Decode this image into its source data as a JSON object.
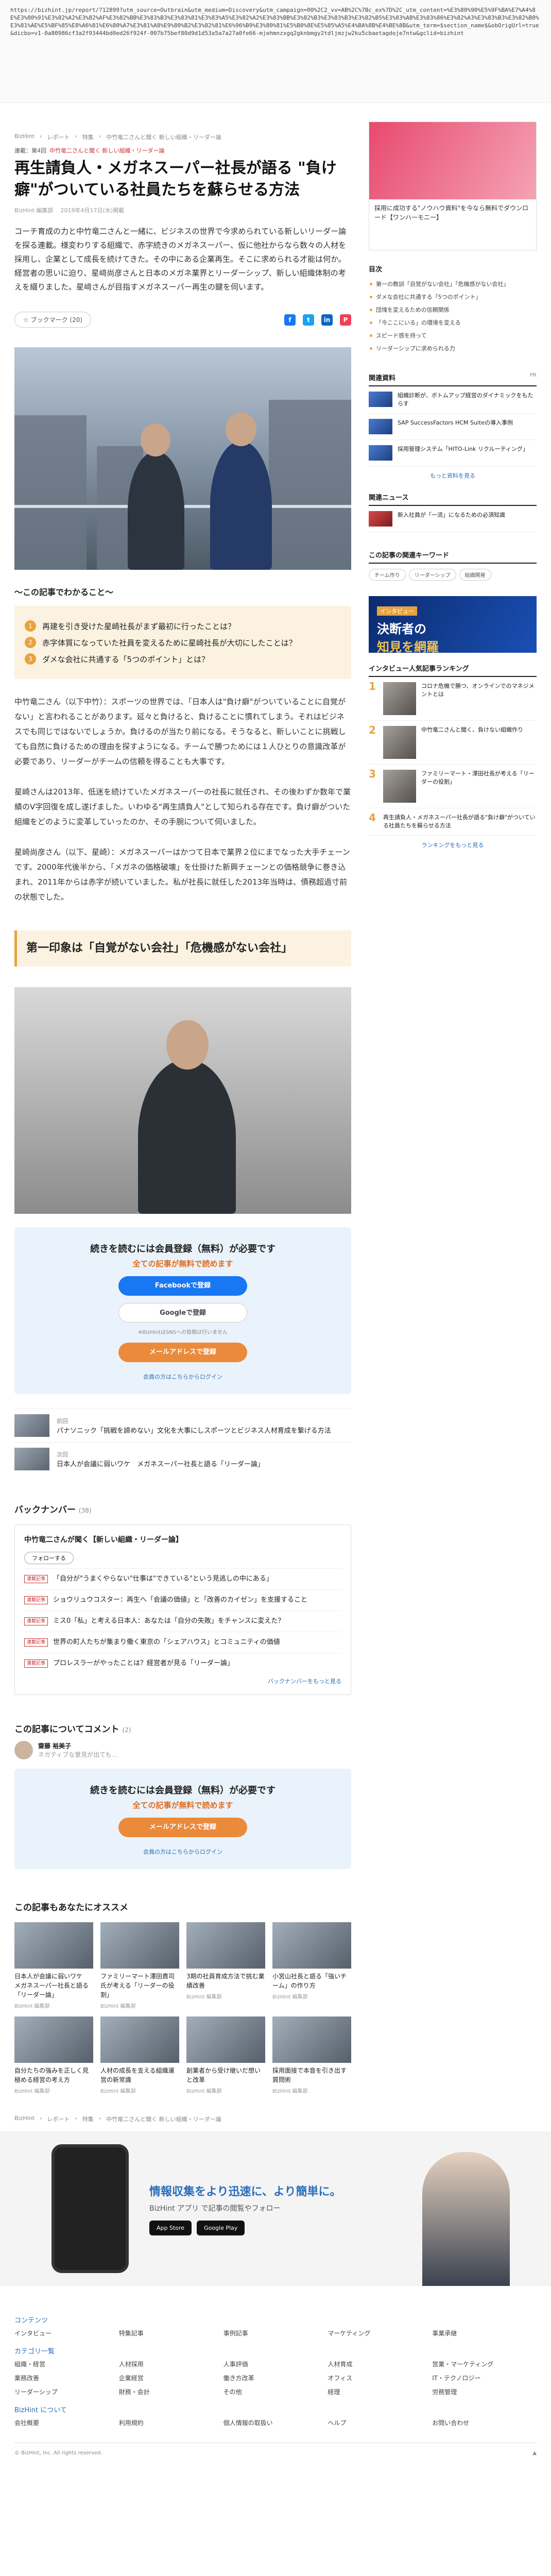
{
  "url_text": "https://bizhint.jp/report/?12899?utm_source=Outbrain&utm_medium=Discovery&utm_campaign=00%2C2_vv=AB%2C%7Bc_ex%7D%2C_utm_content=%E3%80%90%E5%9F%BA%E7%A4%8E%E3%80%91%E3%82%A2%E3%82%AF%E3%82%BB%E3%83%B3%E3%83%81%E3%83%A5%E3%82%A2%E3%83%BB%E3%82%B3%E3%83%B3%E3%82%B5%E3%83%AB%E3%83%86%E3%82%A3%E3%83%B3%E3%82%B0%E3%81%AE%E5%BF%85%E8%A6%81%E6%80%A7%E3%81%A8%E9%80%B2%E3%82%81%E6%96%B9%E3%80%81%E5%B0%8E%E5%85%A5%E4%BA%8B%E4%BE%8B&utm_term=$section_name$&obOrigUrl=true&dicbo=v1-0a80986cf3a2f93444bd0ed26f924f-007b75bef80d9d1d53a5a7a27a0fe66-mjehmnzxgq2gknbmgy2tdljmzjw2ku5cbaetagdoje7ntw&gclid=bizhint",
  "breadcrumb": [
    "BizHint",
    "レポート",
    "特集",
    "中竹竜二さんと聞く 新しい組織・リーダー論"
  ],
  "article": {
    "series_label": "連載：第4回",
    "series_name": "中竹竜二さんと聞く 新しい組織・リーダー論",
    "title": "再生請負人・メガネスーパー社長が語る \"負け癖\"がついている社員たちを蘇らせる方法",
    "byline": "BizHint 編集部",
    "date": "2019年4月17日(水)掲載",
    "lead": "コーチ育成の力と中竹竜二さんと一緒に、ビジネスの世界で今求められている新しいリーダー論を探る連載。様変わりする組織で、赤字続きのメガネスーパー、仮に他社からなら数々の人材を採用し、企業として成長を続けてきた。その中にある企業再生。そこに求められる才能は何か。経営者の思いに迫り、星﨑尚彦さんと日本のメガネ業界とリーダーシップ、新しい組織体制の考えを綴りました。星﨑さんが目指すメガネスーパー再生の鍵を伺います。",
    "bookmark_label": "ブックマーク",
    "bookmark_count": "(20)"
  },
  "toc": {
    "heading": "この記事でわかること",
    "items": [
      "再建を引き受けた星崎社長がまず最初に行ったことは？",
      "赤字体質になっていた社員を変えるために星崎社長が大切にしたことは？",
      "ダメな会社に共通する「5つのポイント」とは？"
    ]
  },
  "paragraphs": [
    "中竹竜二さん（以下中竹）：スポーツの世界では、「日本人は\"負け癖\"がついていることに自覚がない」と言われることがあります。延々と負けると、負けることに慣れてしまう。それはビジネスでも同じではないでしょうか。負けるのが当たり前になる。そうなると、新しいことに挑戦しても自然に負けるための理由を探すようになる。チームで勝つためには１人ひとりの意識改革が必要であり、リーダーがチームの信頼を得ることも大事です。",
    "星崎さんは2013年、低迷を続けていたメガネスーパーの社長に就任され、その後わずか数年で業績のV字回復を成し遂げました。いわゆる\"再生請負人\"として知られる存在です。負け癖がついた組織をどのように変革していったのか、その手腕について伺いました。",
    "星崎尚彦さん（以下、星崎）：メガネスーパーはかつて日本で業界２位にまでなった大手チェーンです。2000年代後半から、「メガネの価格破壊」を仕掛けた新興チェーンとの価格競争に巻き込まれ、2011年からは赤字が続いていました。私が社長に就任した2013年当時は、債務超過寸前の状態でした。"
  ],
  "h2": "第一印象は「自覚がない会社」「危機感がない会社」",
  "gate": {
    "t1": "続きを読むには会員登録（無料）が必要です",
    "t2": "全ての記事が無料で読めます",
    "fb": "Facebookで登録",
    "google": "Googleで登録",
    "note": "※BizHintはSNSへの投稿は行いません",
    "mail": "メールアドレスで登録",
    "login": "会員の方はこちらからログイン"
  },
  "related": [
    {
      "meta": "前回",
      "title": "パナソニック「挑戦を諦めない」文化を大事にしスポーツとビジネス人材育成を繋げる方法"
    },
    {
      "meta": "次回",
      "title": "日本人が会議に弱いワケ　メガネスーパー社長と語る「リーダー論」"
    }
  ],
  "backnumber": {
    "heading": "バックナンバー",
    "count": "(38)",
    "series": "中竹竜二さんが聞く【新しい組織・リーダー論】",
    "follow": "フォローする",
    "tag": "連載記事",
    "items": [
      "「自分が\"うまくやらない\"仕事は\"できている\"という見逃しの中にある」",
      "ショウリュウコスター：再生へ「会議の価値」と「改善のカイゼン」を支援すること",
      "ミス0「私」と考える日本人：あなたは「自分の失敗」をチャンスに変えた？",
      "世界の町人たちが集まり働く東京の「シェアハウス」とコミュニティの価値",
      "プロレスラーがやったことは？経営者が見る「リーダー論」"
    ],
    "more": "バックナンバーをもっと見る"
  },
  "comments": {
    "heading": "この記事についてコメント",
    "count": "(2)",
    "user": "齋藤 裕美子",
    "text": "ネガティブな意見が出ても…"
  },
  "gate2": {
    "t1": "続きを読むには会員登録（無料）が必要です",
    "t2": "全ての記事が無料で読めます",
    "mail": "メールアドレスで登録",
    "login": "会員の方はこちらからログイン"
  },
  "recommend": {
    "heading": "この記事もあなたにオススメ",
    "items": [
      {
        "t": "日本人が会議に弱いワケ　メガネスーパー社長と語る「リーダー論」",
        "m": "BizHint 編集部"
      },
      {
        "t": "ファミリーマート澤田貴司氏が考える「リーダーの役割」",
        "m": "BizHint 編集部"
      },
      {
        "t": "3期の社員育成方法で挑む業績改善",
        "m": "BizHint 編集部"
      },
      {
        "t": "小宮山社長と語る「強いチーム」の作り方",
        "m": "BizHint 編集部"
      },
      {
        "t": "自分たちの強みを正しく見極める経営の考え方",
        "m": "BizHint 編集部"
      },
      {
        "t": "人材の成長を支える組織運営の新常識",
        "m": "BizHint 編集部"
      },
      {
        "t": "創業者から受け継いだ想いと改革",
        "m": "BizHint 編集部"
      },
      {
        "t": "採用面接で本音を引き出す質問術",
        "m": "BizHint 編集部"
      }
    ]
  },
  "foot_breadcrumb": [
    "BizHint",
    "レポート",
    "特集",
    "中竹竜二さんと聞く 新しい組織・リーダー論"
  ],
  "app": {
    "title": "情報収集をより迅速に、より簡単に。",
    "sub": "BizHint アプリ で記事の閲覧やフォロー",
    "appstore": "App Store",
    "googleplay": "Google Play"
  },
  "footer": {
    "h1": "コンテンツ",
    "links1": [
      "インタビュー",
      "特集記事",
      "事例記事",
      "マーケティング",
      "事業承継"
    ],
    "h2": "カテゴリ一覧",
    "links2": [
      "組織・経営",
      "人材採用",
      "人事評価",
      "人材育成",
      "営業・マーケティング",
      "業務改善",
      "企業経営",
      "働き方改革",
      "オフィス",
      "IT・テクノロジー",
      "リーダーシップ",
      "財務・会計",
      "その他",
      "経理",
      "労務管理"
    ],
    "h3": "BizHint について",
    "links3": [
      "会社概要",
      "利用規約",
      "個人情報の取扱い",
      "ヘルプ",
      "お問い合わせ"
    ],
    "copyright": "© BizHint, Inc. All rights reserved."
  },
  "sidebar": {
    "ad_text": "採用に成功する\"ノウハウ資料\"を今なら無料でダウンロード【ワンハーモニー】",
    "toc_heading": "目次",
    "toc": [
      "第一の教訓「自覚がない会社」「危機感がない会社」",
      "ダメな会社に共通する「5つのポイント」",
      "団塊を変えるための信頼関係",
      "「今ここにいる」の環境を変える",
      "スピード感を持って",
      "リーダーシップに求められる力"
    ],
    "related_heading": "関連資料",
    "related_sponsor": "PR",
    "related": [
      "組織診断が、ボトムアップ経営のダイナミックをもたらす",
      "SAP SuccessFactors HCM Suiteの導入事例",
      "採用管理システム「HITO-Link リクルーティング」"
    ],
    "related_more": "もっと資料を見る",
    "news_heading": "関連ニュース",
    "news": [
      "新入社員が「一流」になるための必須知識"
    ],
    "tags_heading": "この記事の関連キーワード",
    "tags": [
      "チーム作り",
      "リーダーシップ",
      "組織開発"
    ],
    "banner_tag": "インタビュー",
    "banner_l1": "決断者の",
    "banner_l2": "知見を網羅",
    "ranking_heading": "インタビュー人気記事ランキング",
    "ranking": [
      "コロナ危機で勝つ、オンラインでのマネジメントとは",
      "中竹竜二さんと聞く、負けない組織作り",
      "ファミリーマート・澤田社長が考える「リーダーの役割」",
      "再生請負人・メガネスーパー社長が語る\"負け癖\"がついている社員たちを蘇らせる方法"
    ],
    "ranking_more": "ランキングをもっと見る"
  }
}
